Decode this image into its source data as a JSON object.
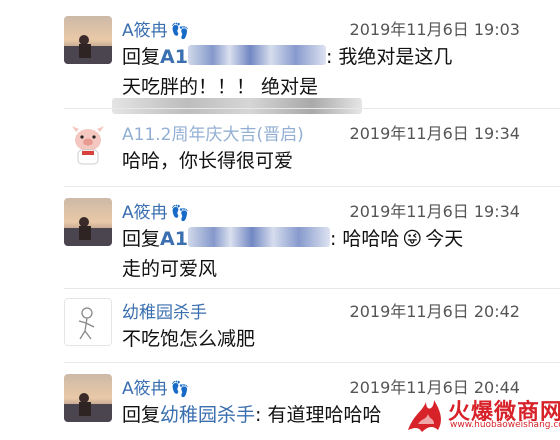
{
  "comments": [
    {
      "author": "A筱冉",
      "time": "2019年11月6日 19:03",
      "reply_prefix": "回复",
      "reply_target": "A11.2周年庆大吉(晋启)",
      "body_line1": ": 我绝对是这几",
      "body_line2": "天吃胖的！！！ 绝对是"
    },
    {
      "author": "A11.2周年庆大吉(晋启)",
      "time": "2019年11月6日 19:34",
      "body": "哈哈，你长得很可爱"
    },
    {
      "author": "A筱冉",
      "time": "2019年11月6日 19:34",
      "reply_prefix": "回复",
      "reply_target": "A11.2周年庆大吉(晋启)",
      "body_line1": ": 哈哈哈",
      "emoji": "😜",
      "body_line1_tail": "今天",
      "body_line2": "走的可爱风"
    },
    {
      "author": "幼稚园杀手",
      "time": "2019年11月6日 20:42",
      "body": "不吃饱怎么减肥"
    },
    {
      "author": "A筱冉",
      "time": "2019年11月6日 20:44",
      "reply_prefix": "回复",
      "reply_target": "幼稚园杀手",
      "body_line1": ": 有道理哈哈哈"
    }
  ],
  "watermark": {
    "text": "火爆微商网",
    "url": "www.huobaoweishang.com"
  },
  "colors": {
    "link": "#3a6fb0",
    "watermark": "#d8222a"
  }
}
